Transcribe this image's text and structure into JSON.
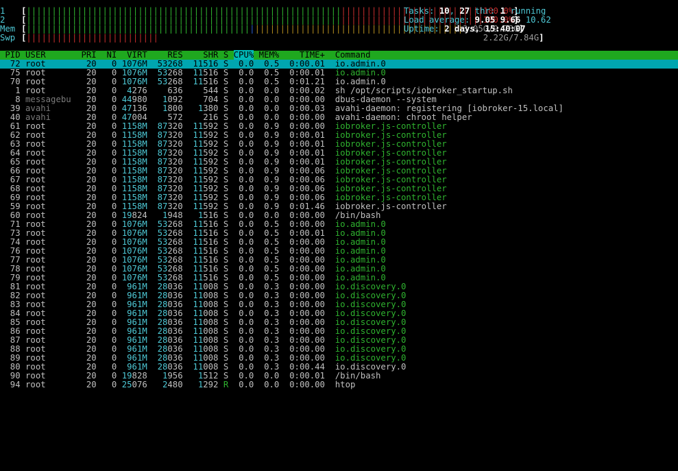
{
  "meters": {
    "cpu1": {
      "label": "1",
      "value": "100.0%"
    },
    "cpu2": {
      "label": "2",
      "value": "100.0%"
    },
    "mem": {
      "label": "Mem",
      "value": "3.05G/9.73G"
    },
    "swp": {
      "label": "Swp",
      "value": "2.22G/7.84G"
    }
  },
  "summary": {
    "tasks_label": "Tasks:",
    "tasks": "10",
    "thr_count": "27",
    "thr_label": "thr:",
    "running": "1",
    "running_label": "running",
    "load_label": "Load average:",
    "load1": "9.05",
    "load5": "9.66",
    "load15": "10.62",
    "uptime_label": "Uptime:",
    "uptime": "2 days, 15:40:07"
  },
  "columns": {
    "pid": "PID",
    "user": "USER",
    "pri": "PRI",
    "ni": "NI",
    "virt": "VIRT",
    "res": "RES",
    "shr": "SHR",
    "s": "S",
    "cpu": "CPU%",
    "mem": "MEM%",
    "time": "TIME+",
    "cmd": "Command"
  },
  "processes": [
    {
      "pid": "72",
      "user": "root",
      "pri": "20",
      "ni": "0",
      "virt": "1076M",
      "res": "53268",
      "shr": "11516",
      "s": "S",
      "cpu": "0.0",
      "mem": "0.5",
      "time": "0:00.01",
      "cmd": "io.admin.0",
      "thread": false
    },
    {
      "pid": "75",
      "user": "root",
      "pri": "20",
      "ni": "0",
      "virt": "1076M",
      "res": "53268",
      "shr": "11516",
      "s": "S",
      "cpu": "0.0",
      "mem": "0.5",
      "time": "0:00.01",
      "cmd": "io.admin.0",
      "thread": true
    },
    {
      "pid": "70",
      "user": "root",
      "pri": "20",
      "ni": "0",
      "virt": "1076M",
      "res": "53268",
      "shr": "11516",
      "s": "S",
      "cpu": "0.0",
      "mem": "0.5",
      "time": "0:01.21",
      "cmd": "io.admin.0",
      "thread": false
    },
    {
      "pid": "1",
      "user": "root",
      "pri": "20",
      "ni": "0",
      "virt": "4276",
      "res": "636",
      "shr": "544",
      "s": "S",
      "cpu": "0.0",
      "mem": "0.0",
      "time": "0:00.02",
      "cmd": "sh /opt/scripts/iobroker_startup.sh",
      "thread": false
    },
    {
      "pid": "8",
      "user": "messagebu",
      "pri": "20",
      "ni": "0",
      "virt": "44980",
      "res": "1092",
      "shr": "704",
      "s": "S",
      "cpu": "0.0",
      "mem": "0.0",
      "time": "0:00.00",
      "cmd": "dbus-daemon --system",
      "thread": false
    },
    {
      "pid": "39",
      "user": "avahi",
      "pri": "20",
      "ni": "0",
      "virt": "47136",
      "res": "1800",
      "shr": "1380",
      "s": "S",
      "cpu": "0.0",
      "mem": "0.0",
      "time": "0:00.03",
      "cmd": "avahi-daemon: registering [iobroker-15.local]",
      "thread": false
    },
    {
      "pid": "40",
      "user": "avahi",
      "pri": "20",
      "ni": "0",
      "virt": "47004",
      "res": "572",
      "shr": "216",
      "s": "S",
      "cpu": "0.0",
      "mem": "0.0",
      "time": "0:00.00",
      "cmd": "avahi-daemon: chroot helper",
      "thread": false
    },
    {
      "pid": "61",
      "user": "root",
      "pri": "20",
      "ni": "0",
      "virt": "1158M",
      "res": "87320",
      "shr": "11592",
      "s": "S",
      "cpu": "0.0",
      "mem": "0.9",
      "time": "0:00.00",
      "cmd": "iobroker.js-controller",
      "thread": true
    },
    {
      "pid": "62",
      "user": "root",
      "pri": "20",
      "ni": "0",
      "virt": "1158M",
      "res": "87320",
      "shr": "11592",
      "s": "S",
      "cpu": "0.0",
      "mem": "0.9",
      "time": "0:00.01",
      "cmd": "iobroker.js-controller",
      "thread": true
    },
    {
      "pid": "63",
      "user": "root",
      "pri": "20",
      "ni": "0",
      "virt": "1158M",
      "res": "87320",
      "shr": "11592",
      "s": "S",
      "cpu": "0.0",
      "mem": "0.9",
      "time": "0:00.01",
      "cmd": "iobroker.js-controller",
      "thread": true
    },
    {
      "pid": "64",
      "user": "root",
      "pri": "20",
      "ni": "0",
      "virt": "1158M",
      "res": "87320",
      "shr": "11592",
      "s": "S",
      "cpu": "0.0",
      "mem": "0.9",
      "time": "0:00.01",
      "cmd": "iobroker.js-controller",
      "thread": true
    },
    {
      "pid": "65",
      "user": "root",
      "pri": "20",
      "ni": "0",
      "virt": "1158M",
      "res": "87320",
      "shr": "11592",
      "s": "S",
      "cpu": "0.0",
      "mem": "0.9",
      "time": "0:00.01",
      "cmd": "iobroker.js-controller",
      "thread": true
    },
    {
      "pid": "66",
      "user": "root",
      "pri": "20",
      "ni": "0",
      "virt": "1158M",
      "res": "87320",
      "shr": "11592",
      "s": "S",
      "cpu": "0.0",
      "mem": "0.9",
      "time": "0:00.06",
      "cmd": "iobroker.js-controller",
      "thread": true
    },
    {
      "pid": "67",
      "user": "root",
      "pri": "20",
      "ni": "0",
      "virt": "1158M",
      "res": "87320",
      "shr": "11592",
      "s": "S",
      "cpu": "0.0",
      "mem": "0.9",
      "time": "0:00.06",
      "cmd": "iobroker.js-controller",
      "thread": true
    },
    {
      "pid": "68",
      "user": "root",
      "pri": "20",
      "ni": "0",
      "virt": "1158M",
      "res": "87320",
      "shr": "11592",
      "s": "S",
      "cpu": "0.0",
      "mem": "0.9",
      "time": "0:00.06",
      "cmd": "iobroker.js-controller",
      "thread": true
    },
    {
      "pid": "69",
      "user": "root",
      "pri": "20",
      "ni": "0",
      "virt": "1158M",
      "res": "87320",
      "shr": "11592",
      "s": "S",
      "cpu": "0.0",
      "mem": "0.9",
      "time": "0:00.06",
      "cmd": "iobroker.js-controller",
      "thread": true
    },
    {
      "pid": "59",
      "user": "root",
      "pri": "20",
      "ni": "0",
      "virt": "1158M",
      "res": "87320",
      "shr": "11592",
      "s": "S",
      "cpu": "0.0",
      "mem": "0.9",
      "time": "0:01.46",
      "cmd": "iobroker.js-controller",
      "thread": false
    },
    {
      "pid": "60",
      "user": "root",
      "pri": "20",
      "ni": "0",
      "virt": "19824",
      "res": "1948",
      "shr": "1516",
      "s": "S",
      "cpu": "0.0",
      "mem": "0.0",
      "time": "0:00.00",
      "cmd": "/bin/bash",
      "thread": false
    },
    {
      "pid": "71",
      "user": "root",
      "pri": "20",
      "ni": "0",
      "virt": "1076M",
      "res": "53268",
      "shr": "11516",
      "s": "S",
      "cpu": "0.0",
      "mem": "0.5",
      "time": "0:00.00",
      "cmd": "io.admin.0",
      "thread": true
    },
    {
      "pid": "73",
      "user": "root",
      "pri": "20",
      "ni": "0",
      "virt": "1076M",
      "res": "53268",
      "shr": "11516",
      "s": "S",
      "cpu": "0.0",
      "mem": "0.5",
      "time": "0:00.01",
      "cmd": "io.admin.0",
      "thread": true
    },
    {
      "pid": "74",
      "user": "root",
      "pri": "20",
      "ni": "0",
      "virt": "1076M",
      "res": "53268",
      "shr": "11516",
      "s": "S",
      "cpu": "0.0",
      "mem": "0.5",
      "time": "0:00.00",
      "cmd": "io.admin.0",
      "thread": true
    },
    {
      "pid": "76",
      "user": "root",
      "pri": "20",
      "ni": "0",
      "virt": "1076M",
      "res": "53268",
      "shr": "11516",
      "s": "S",
      "cpu": "0.0",
      "mem": "0.5",
      "time": "0:00.00",
      "cmd": "io.admin.0",
      "thread": true
    },
    {
      "pid": "77",
      "user": "root",
      "pri": "20",
      "ni": "0",
      "virt": "1076M",
      "res": "53268",
      "shr": "11516",
      "s": "S",
      "cpu": "0.0",
      "mem": "0.5",
      "time": "0:00.00",
      "cmd": "io.admin.0",
      "thread": true
    },
    {
      "pid": "78",
      "user": "root",
      "pri": "20",
      "ni": "0",
      "virt": "1076M",
      "res": "53268",
      "shr": "11516",
      "s": "S",
      "cpu": "0.0",
      "mem": "0.5",
      "time": "0:00.00",
      "cmd": "io.admin.0",
      "thread": true
    },
    {
      "pid": "79",
      "user": "root",
      "pri": "20",
      "ni": "0",
      "virt": "1076M",
      "res": "53268",
      "shr": "11516",
      "s": "S",
      "cpu": "0.0",
      "mem": "0.5",
      "time": "0:00.00",
      "cmd": "io.admin.0",
      "thread": true
    },
    {
      "pid": "81",
      "user": "root",
      "pri": "20",
      "ni": "0",
      "virt": "961M",
      "res": "28036",
      "shr": "11008",
      "s": "S",
      "cpu": "0.0",
      "mem": "0.3",
      "time": "0:00.00",
      "cmd": "io.discovery.0",
      "thread": true
    },
    {
      "pid": "82",
      "user": "root",
      "pri": "20",
      "ni": "0",
      "virt": "961M",
      "res": "28036",
      "shr": "11008",
      "s": "S",
      "cpu": "0.0",
      "mem": "0.3",
      "time": "0:00.00",
      "cmd": "io.discovery.0",
      "thread": true
    },
    {
      "pid": "83",
      "user": "root",
      "pri": "20",
      "ni": "0",
      "virt": "961M",
      "res": "28036",
      "shr": "11008",
      "s": "S",
      "cpu": "0.0",
      "mem": "0.3",
      "time": "0:00.00",
      "cmd": "io.discovery.0",
      "thread": true
    },
    {
      "pid": "84",
      "user": "root",
      "pri": "20",
      "ni": "0",
      "virt": "961M",
      "res": "28036",
      "shr": "11008",
      "s": "S",
      "cpu": "0.0",
      "mem": "0.3",
      "time": "0:00.00",
      "cmd": "io.discovery.0",
      "thread": true
    },
    {
      "pid": "85",
      "user": "root",
      "pri": "20",
      "ni": "0",
      "virt": "961M",
      "res": "28036",
      "shr": "11008",
      "s": "S",
      "cpu": "0.0",
      "mem": "0.3",
      "time": "0:00.00",
      "cmd": "io.discovery.0",
      "thread": true
    },
    {
      "pid": "86",
      "user": "root",
      "pri": "20",
      "ni": "0",
      "virt": "961M",
      "res": "28036",
      "shr": "11008",
      "s": "S",
      "cpu": "0.0",
      "mem": "0.3",
      "time": "0:00.00",
      "cmd": "io.discovery.0",
      "thread": true
    },
    {
      "pid": "87",
      "user": "root",
      "pri": "20",
      "ni": "0",
      "virt": "961M",
      "res": "28036",
      "shr": "11008",
      "s": "S",
      "cpu": "0.0",
      "mem": "0.3",
      "time": "0:00.00",
      "cmd": "io.discovery.0",
      "thread": true
    },
    {
      "pid": "88",
      "user": "root",
      "pri": "20",
      "ni": "0",
      "virt": "961M",
      "res": "28036",
      "shr": "11008",
      "s": "S",
      "cpu": "0.0",
      "mem": "0.3",
      "time": "0:00.00",
      "cmd": "io.discovery.0",
      "thread": true
    },
    {
      "pid": "89",
      "user": "root",
      "pri": "20",
      "ni": "0",
      "virt": "961M",
      "res": "28036",
      "shr": "11008",
      "s": "S",
      "cpu": "0.0",
      "mem": "0.3",
      "time": "0:00.00",
      "cmd": "io.discovery.0",
      "thread": true
    },
    {
      "pid": "80",
      "user": "root",
      "pri": "20",
      "ni": "0",
      "virt": "961M",
      "res": "28036",
      "shr": "11008",
      "s": "S",
      "cpu": "0.0",
      "mem": "0.3",
      "time": "0:00.44",
      "cmd": "io.discovery.0",
      "thread": false
    },
    {
      "pid": "90",
      "user": "root",
      "pri": "20",
      "ni": "0",
      "virt": "19828",
      "res": "1956",
      "shr": "1512",
      "s": "S",
      "cpu": "0.0",
      "mem": "0.0",
      "time": "0:00.01",
      "cmd": "/bin/bash",
      "thread": false
    },
    {
      "pid": "94",
      "user": "root",
      "pri": "20",
      "ni": "0",
      "virt": "25076",
      "res": "2480",
      "shr": "1292",
      "s": "R",
      "cpu": "0.0",
      "mem": "0.0",
      "time": "0:00.00",
      "cmd": "htop",
      "thread": false
    }
  ],
  "colors": {
    "cyan": "#4ec9d6",
    "green": "#2fb32f",
    "red": "#c42d2d",
    "header_bg": "#1fa81f",
    "selected_bg": "#00a6b0"
  }
}
